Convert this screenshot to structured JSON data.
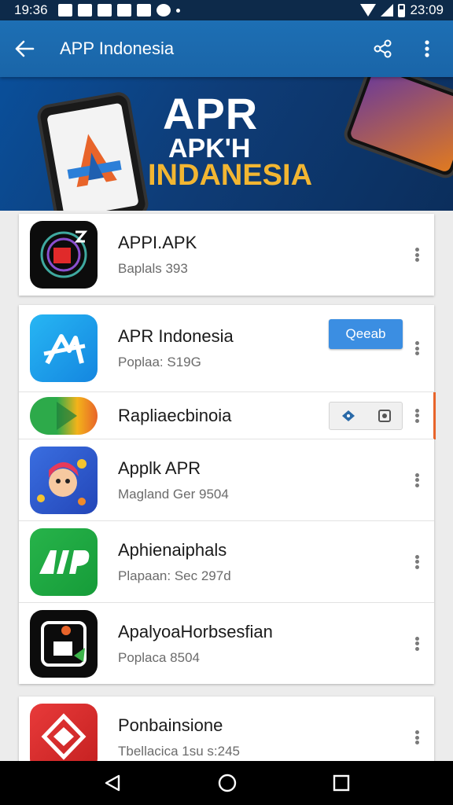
{
  "status_bar": {
    "time_left": "19:36",
    "time_right": "23:09"
  },
  "app_bar": {
    "title": "APP Indonesia"
  },
  "banner": {
    "line1": "APR",
    "line2": "APK'H",
    "line3": "INDANESIA"
  },
  "cards": [
    {
      "apps": [
        {
          "name": "APPI.APK",
          "subtitle": "Baplals 393"
        }
      ]
    },
    {
      "apps": [
        {
          "name": "APR Indonesia",
          "subtitle": "Poplaa: S19G",
          "button": "Qeeab"
        },
        {
          "name": "Rapliaecbinoia",
          "subtitle": ""
        },
        {
          "name": "Applk APR",
          "subtitle": "Magland Ger 9504"
        },
        {
          "name": "Aphienaiphals",
          "subtitle": "Plapaan:  Sec 297d"
        },
        {
          "name": "ApalyoaHorbsesfian",
          "subtitle": "Poplaca 8504"
        }
      ]
    },
    {
      "apps": [
        {
          "name": "Ponbainsione",
          "subtitle": "Tbellacica  1su s:245"
        }
      ]
    }
  ],
  "colors": {
    "app_bar": "#1d6fb4",
    "accent_button": "#3b8ee2",
    "banner_gold": "#f2b632"
  },
  "icons": [
    "arrow-left-icon",
    "share-icon",
    "more-vert-icon",
    "back-triangle-icon",
    "home-circle-icon",
    "recents-square-icon"
  ]
}
